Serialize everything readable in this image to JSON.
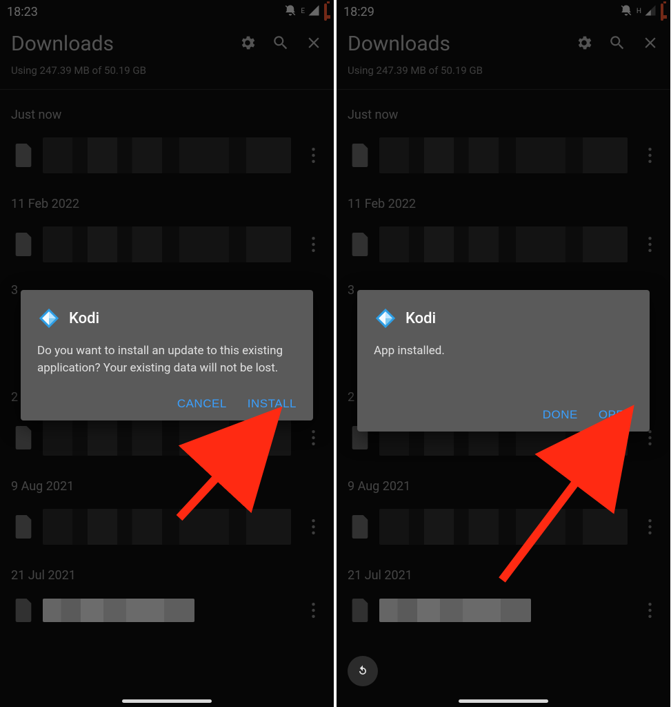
{
  "left": {
    "status": {
      "time": "18:23",
      "net": "E"
    },
    "header": {
      "title": "Downloads"
    },
    "storage_line": "Using 247.39 MB of 50.19 GB",
    "sections": {
      "s0": "Just now",
      "s1": "11 Feb 2022",
      "s2": "3",
      "s3": "2",
      "s4": "9 Aug 2021",
      "s5": "21 Jul 2021"
    },
    "dialog": {
      "app": "Kodi",
      "body": "Do you want to install an update to this existing application? Your existing data will not be lost.",
      "cancel": "CANCEL",
      "confirm": "INSTALL"
    }
  },
  "right": {
    "status": {
      "time": "18:29",
      "net": "H"
    },
    "header": {
      "title": "Downloads"
    },
    "storage_line": "Using 247.39 MB of 50.19 GB",
    "sections": {
      "s0": "Just now",
      "s1": "11 Feb 2022",
      "s2": "3",
      "s3": "2",
      "s4": "9 Aug 2021",
      "s5": "21 Jul 2021"
    },
    "dialog": {
      "app": "Kodi",
      "body": "App installed.",
      "done": "DONE",
      "open": "OPEN"
    }
  }
}
